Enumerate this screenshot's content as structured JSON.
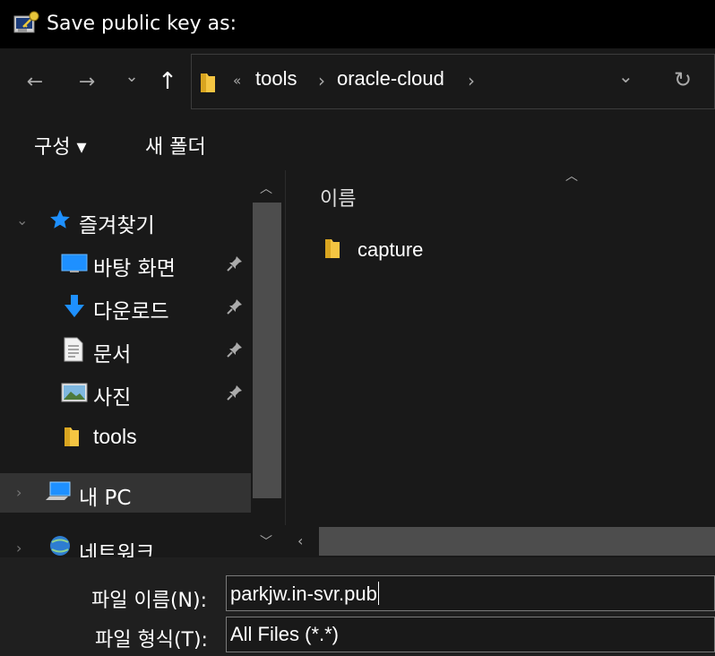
{
  "window": {
    "title": "Save public key as:",
    "icon": "puttygen-key-icon"
  },
  "nav": {
    "back": "←",
    "forward": "→",
    "recent": "⌄",
    "up": "↑"
  },
  "address": {
    "overflow": "«",
    "crumbs": [
      "tools",
      "oracle-cloud"
    ],
    "separator": "›",
    "dropdown": "⌄",
    "refresh": "↻"
  },
  "commands": {
    "organize": "구성 ▾",
    "new_folder": "새 폴더"
  },
  "sidebar": {
    "items": [
      {
        "label": "즐겨찾기",
        "icon": "star-icon"
      },
      {
        "label": "바탕 화면",
        "icon": "desktop-icon",
        "pinned": true
      },
      {
        "label": "다운로드",
        "icon": "download-icon",
        "pinned": true
      },
      {
        "label": "문서",
        "icon": "document-icon",
        "pinned": true
      },
      {
        "label": "사진",
        "icon": "pictures-icon",
        "pinned": true
      },
      {
        "label": "tools",
        "icon": "folder-icon"
      },
      {
        "label": "내 PC",
        "icon": "pc-icon"
      },
      {
        "label": "네트워크",
        "icon": "network-icon"
      }
    ]
  },
  "content": {
    "column_header": "이름",
    "files": [
      {
        "name": "capture",
        "icon": "folder-icon"
      }
    ]
  },
  "form": {
    "filename_label": "파일 이름(N):",
    "filename_value": "parkjw.in-svr.pub",
    "filetype_label": "파일 형식(T):",
    "filetype_value": "All Files (*.*)"
  },
  "colors": {
    "background": "#191919",
    "accent": "#1e90ff",
    "folder": "#f4c542"
  }
}
